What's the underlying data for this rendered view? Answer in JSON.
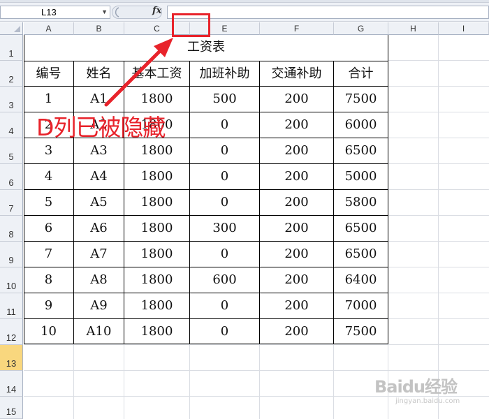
{
  "formula_bar": {
    "name_box_value": "L13",
    "fx_label": "fx",
    "formula_value": ""
  },
  "columns": [
    "A",
    "B",
    "C",
    "E",
    "F",
    "G",
    "H",
    "I"
  ],
  "rows": [
    "1",
    "2",
    "3",
    "4",
    "5",
    "6",
    "7",
    "8",
    "9",
    "10",
    "11",
    "12",
    "13",
    "14",
    "15"
  ],
  "active_row": "13",
  "sheet": {
    "title": "工资表",
    "headers": [
      "编号",
      "姓名",
      "基本工资",
      "加班补助",
      "交通补助",
      "合计"
    ],
    "rows": [
      [
        "1",
        "A1",
        "1800",
        "500",
        "200",
        "7500"
      ],
      [
        "2",
        "A2",
        "1800",
        "0",
        "200",
        "6000"
      ],
      [
        "3",
        "A3",
        "1800",
        "0",
        "200",
        "6500"
      ],
      [
        "4",
        "A4",
        "1800",
        "0",
        "200",
        "5000"
      ],
      [
        "5",
        "A5",
        "1800",
        "0",
        "200",
        "5800"
      ],
      [
        "6",
        "A6",
        "1800",
        "300",
        "200",
        "6500"
      ],
      [
        "7",
        "A7",
        "1800",
        "0",
        "200",
        "6500"
      ],
      [
        "8",
        "A8",
        "1800",
        "600",
        "200",
        "6400"
      ],
      [
        "9",
        "A9",
        "1800",
        "0",
        "200",
        "7000"
      ],
      [
        "10",
        "A10",
        "1800",
        "0",
        "200",
        "7500"
      ]
    ]
  },
  "annotation": {
    "text": "D列已被隐藏",
    "color": "#e8232b"
  },
  "watermark": {
    "logo": "Baidu经验",
    "url": "jingyan.baidu.com"
  },
  "colors": {
    "header_bg": "#eef1f6",
    "active_row_bg": "#f9d77e",
    "annotation_red": "#e8232b"
  }
}
